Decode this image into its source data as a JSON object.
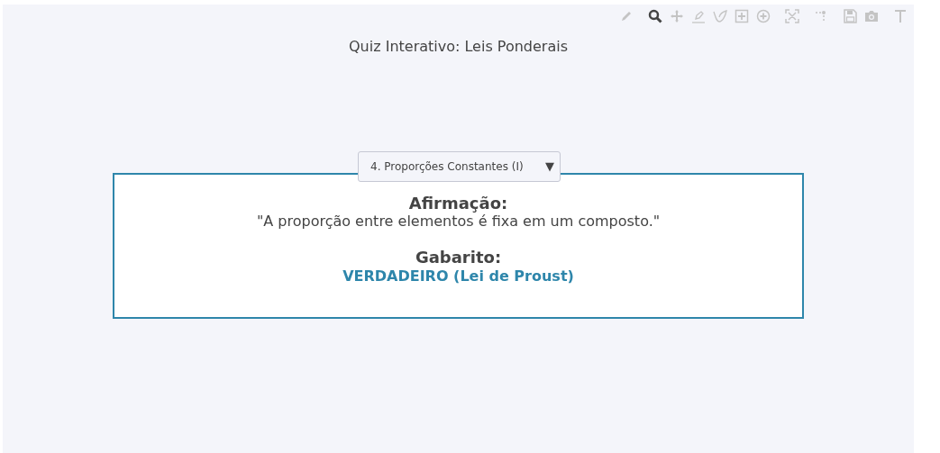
{
  "title": "Quiz Interativo: Leis Ponderais",
  "modebar": [
    [
      {
        "kind": "pencil",
        "selected": false
      }
    ],
    [
      {
        "kind": "zoom",
        "selected": true
      },
      {
        "kind": "pan",
        "selected": false
      },
      {
        "kind": "drawline",
        "selected": false
      },
      {
        "kind": "drawclosedpath",
        "selected": false
      },
      {
        "kind": "drawrect",
        "selected": false
      },
      {
        "kind": "drawcircle",
        "selected": false
      }
    ],
    [
      {
        "kind": "autoscale",
        "selected": false
      }
    ],
    [
      {
        "kind": "spikelines",
        "selected": false
      }
    ],
    [
      {
        "kind": "save",
        "selected": false
      },
      {
        "kind": "camera",
        "selected": false
      }
    ],
    [
      {
        "kind": "text",
        "selected": false
      }
    ]
  ],
  "dropdown": {
    "value": "4. Proporções Constantes (I)",
    "caret": "▼"
  },
  "card": {
    "statement_heading": "Afirmação:",
    "statement": "\"A proporção entre elementos é fixa em um composto.\"",
    "answer_heading": "Gabarito:",
    "answer": "VERDADEIRO (Lei de Proust)"
  }
}
